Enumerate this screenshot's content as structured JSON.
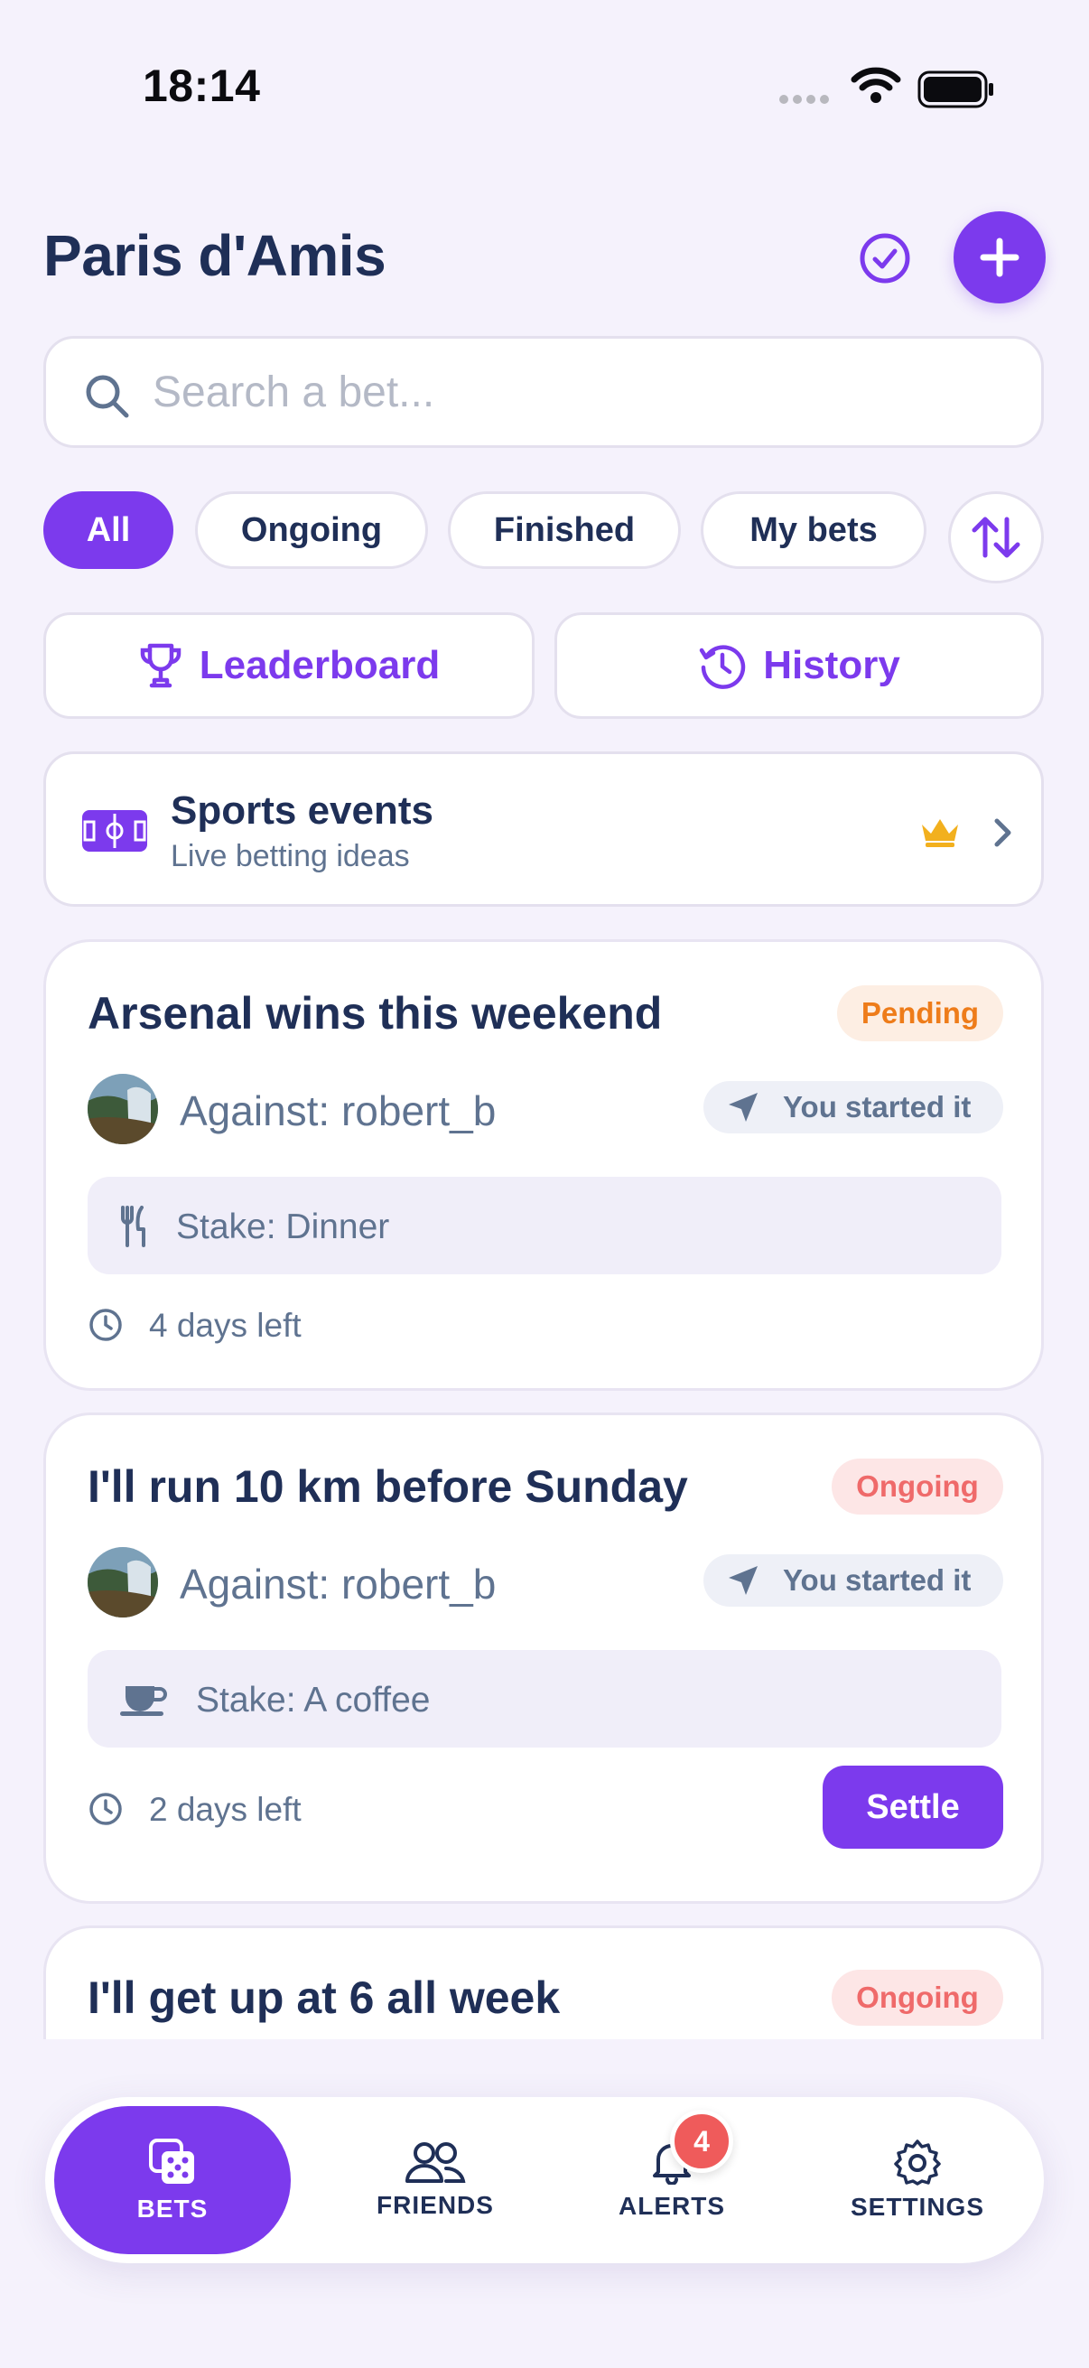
{
  "status_bar": {
    "time": "18:14"
  },
  "header": {
    "title": "Paris d'Amis"
  },
  "search": {
    "placeholder": "Search a bet...",
    "value": ""
  },
  "filters": {
    "chips": [
      "All",
      "Ongoing",
      "Finished",
      "My bets"
    ],
    "active": "All"
  },
  "quick_links": {
    "leaderboard": "Leaderboard",
    "history": "History"
  },
  "sports": {
    "title": "Sports events",
    "subtitle": "Live betting ideas"
  },
  "bets": [
    {
      "title": "Arsenal wins this weekend",
      "status": "Pending",
      "against": "Against: robert_b",
      "started": "You started it",
      "stake": "Stake: Dinner",
      "stake_icon": "fork-knife-icon",
      "time_left": "4 days left"
    },
    {
      "title": "I'll run 10 km before Sunday",
      "status": "Ongoing",
      "against": "Against: robert_b",
      "started": "You started it",
      "stake": "Stake: A coffee",
      "stake_icon": "coffee-cup-icon",
      "time_left": "2 days left",
      "action": "Settle"
    },
    {
      "title": "I'll get up at 6 all week",
      "status": "Ongoing"
    }
  ],
  "tabbar": {
    "tabs": [
      "BETS",
      "FRIENDS",
      "ALERTS",
      "SETTINGS"
    ],
    "active": "BETS",
    "alerts_count": "4"
  },
  "colors": {
    "accent": "#7c3aed",
    "pending": "#ee7c1a",
    "ongoing": "#ef6a6a",
    "crown": "#f2b01e",
    "background": "#f5f2fc"
  }
}
